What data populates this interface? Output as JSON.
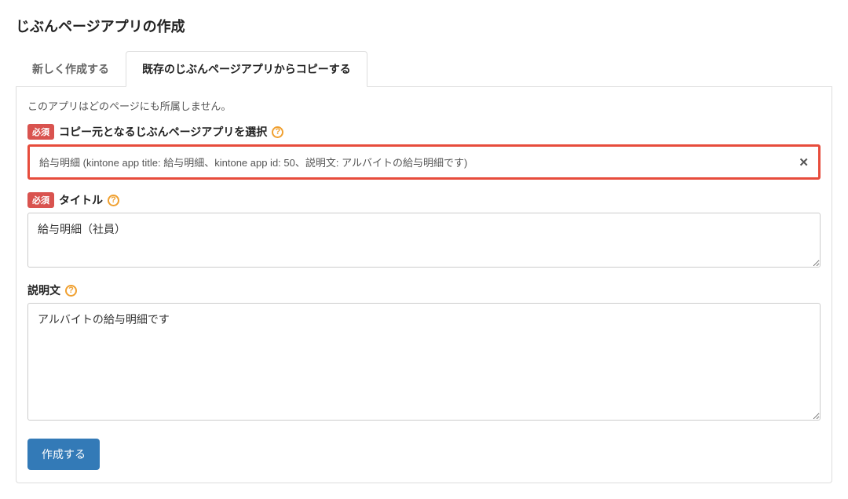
{
  "pageTitle": "じぶんページアプリの作成",
  "tabs": [
    {
      "label": "新しく作成する"
    },
    {
      "label": "既存のじぶんページアプリからコピーする"
    }
  ],
  "notice": "このアプリはどのページにも所属しません。",
  "requiredBadge": "必須",
  "fields": {
    "copySource": {
      "label": "コピー元となるじぶんページアプリを選択",
      "value": "給与明細 (kintone app title: 給与明細、kintone app id: 50、説明文: アルバイトの給与明細です)"
    },
    "title": {
      "label": "タイトル",
      "value": "給与明細（社員）"
    },
    "description": {
      "label": "説明文",
      "value": "アルバイトの給与明細です"
    }
  },
  "helpGlyph": "?",
  "clearGlyph": "✕",
  "submitLabel": "作成する"
}
